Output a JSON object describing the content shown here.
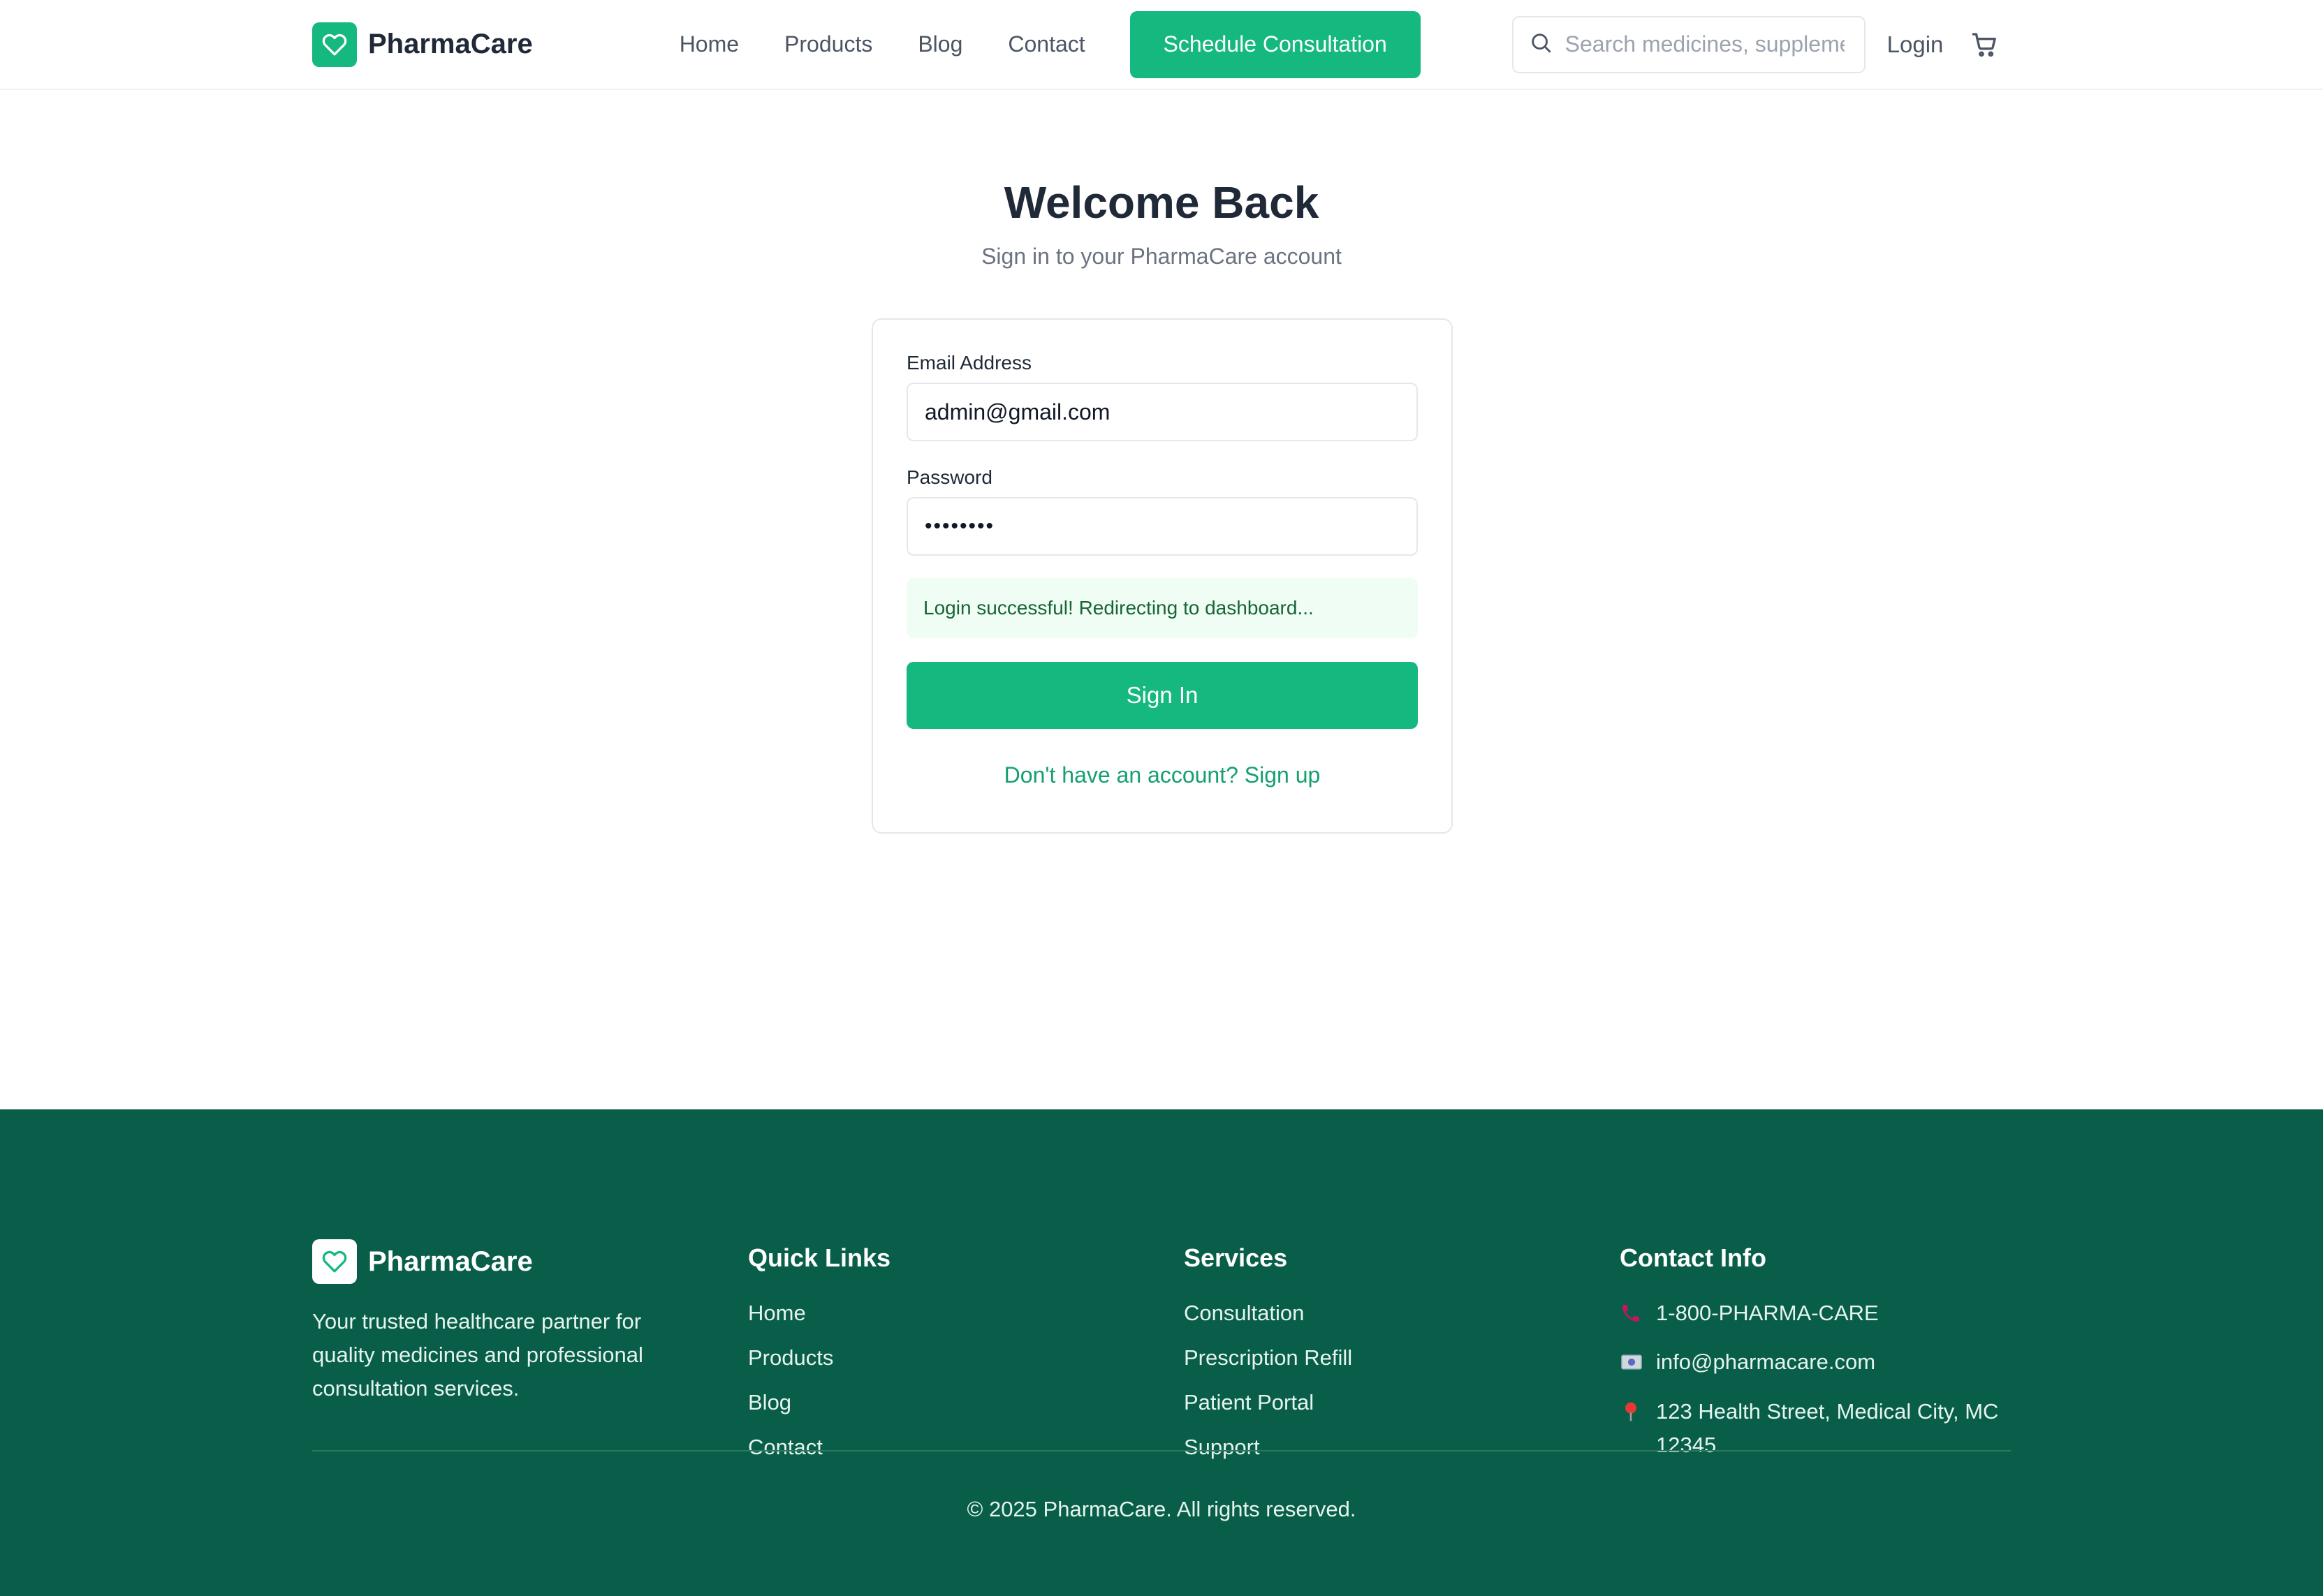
{
  "header": {
    "brand": "PharmaCare",
    "nav": [
      "Home",
      "Products",
      "Blog",
      "Contact"
    ],
    "cta_label": "Schedule Consultation",
    "search_placeholder": "Search medicines, supplements...",
    "login_label": "Login"
  },
  "login": {
    "title": "Welcome Back",
    "subtitle": "Sign in to your PharmaCare account",
    "email_label": "Email Address",
    "email_value": "admin@gmail.com",
    "password_label": "Password",
    "password_value": "••••••••",
    "alert": "Login successful! Redirecting to dashboard...",
    "submit_label": "Sign In",
    "signup_link": "Don't have an account? Sign up"
  },
  "footer": {
    "brand": "PharmaCare",
    "description": "Your trusted healthcare partner for quality medicines and professional consultation services.",
    "quick_links": {
      "title": "Quick Links",
      "items": [
        "Home",
        "Products",
        "Blog",
        "Contact"
      ]
    },
    "services": {
      "title": "Services",
      "items": [
        "Consultation",
        "Prescription Refill",
        "Patient Portal",
        "Support"
      ]
    },
    "contact": {
      "title": "Contact Info",
      "phone": "1-800-PHARMA-CARE",
      "email": "info@pharmacare.com",
      "address": "123 Health Street, Medical City, MC 12345"
    },
    "copyright": "© 2025 PharmaCare. All rights reserved."
  },
  "colors": {
    "accent": "#15b87e",
    "footer_bg": "#085e48",
    "alert_bg": "#f0fdf4",
    "alert_text": "#166534"
  },
  "icons": [
    "heart-icon",
    "search-icon",
    "cart-icon",
    "phone-icon",
    "email-icon",
    "location-pin-icon"
  ]
}
